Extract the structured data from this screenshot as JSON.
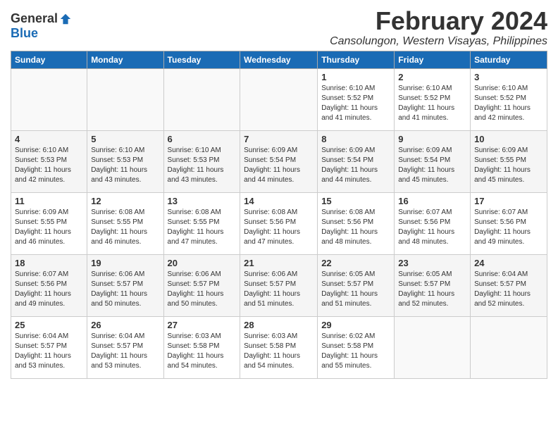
{
  "logo": {
    "general": "General",
    "blue": "Blue"
  },
  "title": "February 2024",
  "location": "Cansolungon, Western Visayas, Philippines",
  "days_of_week": [
    "Sunday",
    "Monday",
    "Tuesday",
    "Wednesday",
    "Thursday",
    "Friday",
    "Saturday"
  ],
  "weeks": [
    [
      {
        "day": "",
        "info": ""
      },
      {
        "day": "",
        "info": ""
      },
      {
        "day": "",
        "info": ""
      },
      {
        "day": "",
        "info": ""
      },
      {
        "day": "1",
        "info": "Sunrise: 6:10 AM\nSunset: 5:52 PM\nDaylight: 11 hours and 41 minutes."
      },
      {
        "day": "2",
        "info": "Sunrise: 6:10 AM\nSunset: 5:52 PM\nDaylight: 11 hours and 41 minutes."
      },
      {
        "day": "3",
        "info": "Sunrise: 6:10 AM\nSunset: 5:52 PM\nDaylight: 11 hours and 42 minutes."
      }
    ],
    [
      {
        "day": "4",
        "info": "Sunrise: 6:10 AM\nSunset: 5:53 PM\nDaylight: 11 hours and 42 minutes."
      },
      {
        "day": "5",
        "info": "Sunrise: 6:10 AM\nSunset: 5:53 PM\nDaylight: 11 hours and 43 minutes."
      },
      {
        "day": "6",
        "info": "Sunrise: 6:10 AM\nSunset: 5:53 PM\nDaylight: 11 hours and 43 minutes."
      },
      {
        "day": "7",
        "info": "Sunrise: 6:09 AM\nSunset: 5:54 PM\nDaylight: 11 hours and 44 minutes."
      },
      {
        "day": "8",
        "info": "Sunrise: 6:09 AM\nSunset: 5:54 PM\nDaylight: 11 hours and 44 minutes."
      },
      {
        "day": "9",
        "info": "Sunrise: 6:09 AM\nSunset: 5:54 PM\nDaylight: 11 hours and 45 minutes."
      },
      {
        "day": "10",
        "info": "Sunrise: 6:09 AM\nSunset: 5:55 PM\nDaylight: 11 hours and 45 minutes."
      }
    ],
    [
      {
        "day": "11",
        "info": "Sunrise: 6:09 AM\nSunset: 5:55 PM\nDaylight: 11 hours and 46 minutes."
      },
      {
        "day": "12",
        "info": "Sunrise: 6:08 AM\nSunset: 5:55 PM\nDaylight: 11 hours and 46 minutes."
      },
      {
        "day": "13",
        "info": "Sunrise: 6:08 AM\nSunset: 5:55 PM\nDaylight: 11 hours and 47 minutes."
      },
      {
        "day": "14",
        "info": "Sunrise: 6:08 AM\nSunset: 5:56 PM\nDaylight: 11 hours and 47 minutes."
      },
      {
        "day": "15",
        "info": "Sunrise: 6:08 AM\nSunset: 5:56 PM\nDaylight: 11 hours and 48 minutes."
      },
      {
        "day": "16",
        "info": "Sunrise: 6:07 AM\nSunset: 5:56 PM\nDaylight: 11 hours and 48 minutes."
      },
      {
        "day": "17",
        "info": "Sunrise: 6:07 AM\nSunset: 5:56 PM\nDaylight: 11 hours and 49 minutes."
      }
    ],
    [
      {
        "day": "18",
        "info": "Sunrise: 6:07 AM\nSunset: 5:56 PM\nDaylight: 11 hours and 49 minutes."
      },
      {
        "day": "19",
        "info": "Sunrise: 6:06 AM\nSunset: 5:57 PM\nDaylight: 11 hours and 50 minutes."
      },
      {
        "day": "20",
        "info": "Sunrise: 6:06 AM\nSunset: 5:57 PM\nDaylight: 11 hours and 50 minutes."
      },
      {
        "day": "21",
        "info": "Sunrise: 6:06 AM\nSunset: 5:57 PM\nDaylight: 11 hours and 51 minutes."
      },
      {
        "day": "22",
        "info": "Sunrise: 6:05 AM\nSunset: 5:57 PM\nDaylight: 11 hours and 51 minutes."
      },
      {
        "day": "23",
        "info": "Sunrise: 6:05 AM\nSunset: 5:57 PM\nDaylight: 11 hours and 52 minutes."
      },
      {
        "day": "24",
        "info": "Sunrise: 6:04 AM\nSunset: 5:57 PM\nDaylight: 11 hours and 52 minutes."
      }
    ],
    [
      {
        "day": "25",
        "info": "Sunrise: 6:04 AM\nSunset: 5:57 PM\nDaylight: 11 hours and 53 minutes."
      },
      {
        "day": "26",
        "info": "Sunrise: 6:04 AM\nSunset: 5:57 PM\nDaylight: 11 hours and 53 minutes."
      },
      {
        "day": "27",
        "info": "Sunrise: 6:03 AM\nSunset: 5:58 PM\nDaylight: 11 hours and 54 minutes."
      },
      {
        "day": "28",
        "info": "Sunrise: 6:03 AM\nSunset: 5:58 PM\nDaylight: 11 hours and 54 minutes."
      },
      {
        "day": "29",
        "info": "Sunrise: 6:02 AM\nSunset: 5:58 PM\nDaylight: 11 hours and 55 minutes."
      },
      {
        "day": "",
        "info": ""
      },
      {
        "day": "",
        "info": ""
      }
    ]
  ]
}
